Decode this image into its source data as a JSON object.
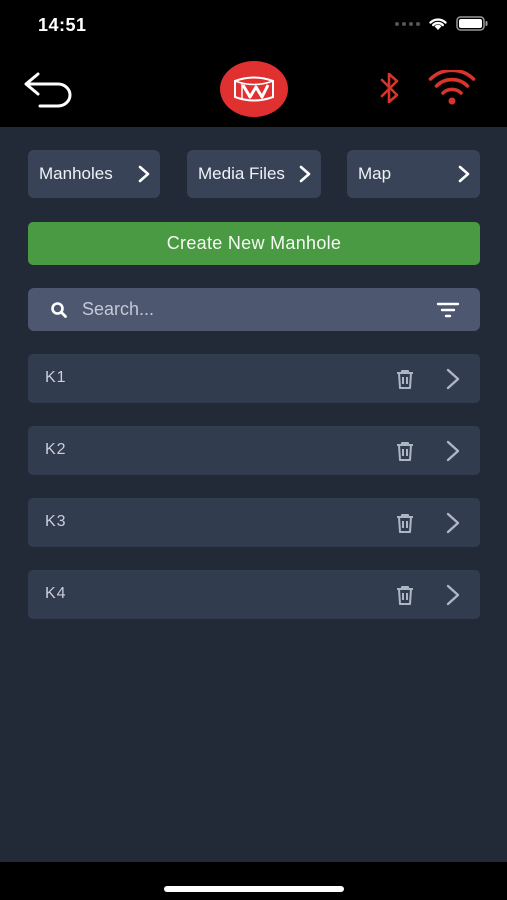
{
  "status_bar": {
    "time": "14:51"
  },
  "header": {
    "back_icon": "back-arrow-icon",
    "logo_icon": "app-logo",
    "bluetooth_icon": "bluetooth-icon",
    "wifi_icon": "wifi-icon",
    "status_color": "#d9342b"
  },
  "nav": {
    "manholes": "Manholes",
    "media_files": "Media Files",
    "map": "Map"
  },
  "actions": {
    "create": "Create New Manhole"
  },
  "search": {
    "placeholder": "Search..."
  },
  "manholes": [
    {
      "name": "K1"
    },
    {
      "name": "K2"
    },
    {
      "name": "K3"
    },
    {
      "name": "K4"
    }
  ],
  "colors": {
    "background": "#222a38",
    "card": "#323c4f",
    "create_button": "#4a9a43",
    "logo": "#e03030"
  }
}
